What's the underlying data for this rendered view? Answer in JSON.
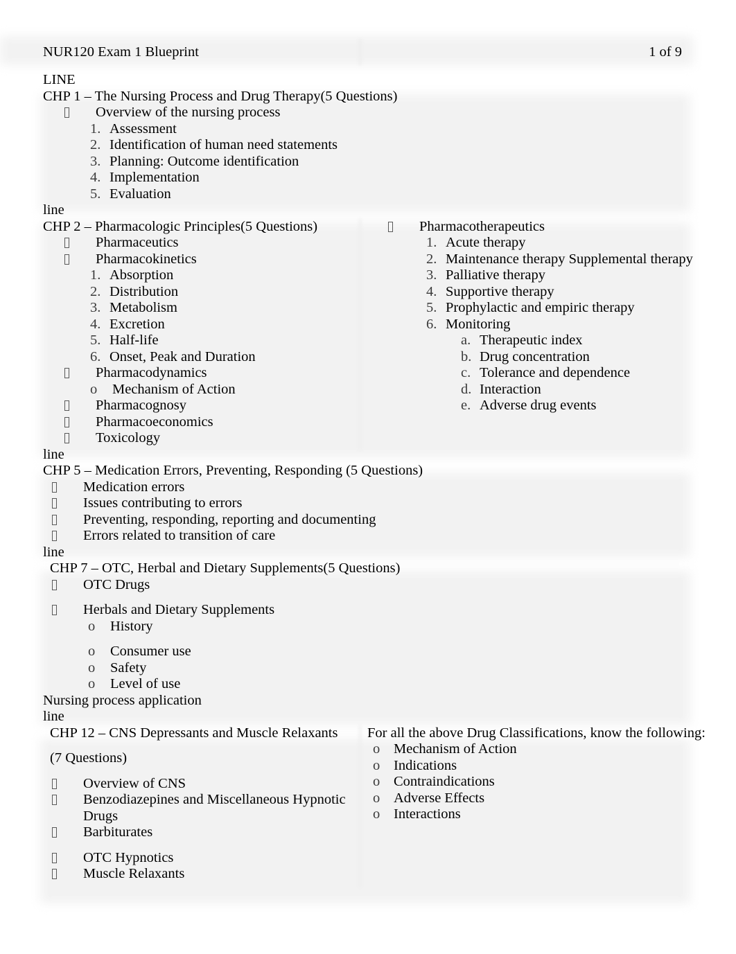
{
  "header": {
    "title": "NUR120 Exam 1 Blueprint",
    "page_indicator": "1 of 9"
  },
  "separators": {
    "upper": "LINE",
    "lower": "line"
  },
  "sections": [
    {
      "id": "chp1",
      "title": "CHP 1 – The Nursing Process and Drug Therapy(5 Questions)",
      "bullets": [
        {
          "marker": "tofu",
          "text": "Overview of the nursing process"
        }
      ],
      "numbered": [
        {
          "marker": "1.",
          "text": "Assessment"
        },
        {
          "marker": "2.",
          "text": "Identification of human need statements"
        },
        {
          "marker": "3.",
          "text": "Planning: Outcome identification"
        },
        {
          "marker": "4.",
          "text": "Implementation"
        },
        {
          "marker": "5.",
          "text": "Evaluation"
        }
      ]
    },
    {
      "id": "chp2",
      "title": "CHP 2 – Pharmacologic Principles(5 Questions)",
      "left_items": [
        {
          "depth": "b1",
          "marker": "tofu",
          "text": "Pharmaceutics"
        },
        {
          "depth": "b1",
          "marker": "tofu",
          "text": "Pharmacokinetics"
        },
        {
          "depth": "n2",
          "marker": "1.",
          "text": "Absorption"
        },
        {
          "depth": "n2",
          "marker": "2.",
          "text": "Distribution"
        },
        {
          "depth": "n2",
          "marker": "3.",
          "text": "Metabolism"
        },
        {
          "depth": "n2",
          "marker": "4.",
          "text": "Excretion"
        },
        {
          "depth": "n2",
          "marker": "5.",
          "text": "Half-life"
        },
        {
          "depth": "n2",
          "marker": "6.",
          "text": "Onset, Peak and Duration"
        },
        {
          "depth": "b1",
          "marker": "tofu",
          "text": "Pharmacodynamics"
        },
        {
          "depth": "o3",
          "marker": "o",
          "text": "Mechanism of Action"
        },
        {
          "depth": "b1",
          "marker": "tofu",
          "text": "Pharmacognosy"
        },
        {
          "depth": "b1",
          "marker": "tofu",
          "text": "Pharmacoeconomics"
        },
        {
          "depth": "b1",
          "marker": "tofu",
          "text": "Toxicology"
        }
      ],
      "right_items": [
        {
          "depth": "rb1",
          "marker": "tofu",
          "text": "Pharmacotherapeutics"
        },
        {
          "depth": "rn2",
          "marker": "1.",
          "text": "Acute therapy"
        },
        {
          "depth": "rn2",
          "marker": "2.",
          "text": "Maintenance therapy Supplemental therapy"
        },
        {
          "depth": "rn2",
          "marker": "3.",
          "text": "Palliative therapy"
        },
        {
          "depth": "rn2",
          "marker": "4.",
          "text": "Supportive therapy"
        },
        {
          "depth": "rn2",
          "marker": "5.",
          "text": "Prophylactic and empiric therapy"
        },
        {
          "depth": "rn2",
          "marker": "6.",
          "text": "Monitoring"
        },
        {
          "depth": "ra3",
          "marker": "a.",
          "text": "Therapeutic index"
        },
        {
          "depth": "ra3",
          "marker": "b.",
          "text": "Drug concentration"
        },
        {
          "depth": "ra3",
          "marker": "c.",
          "text": "Tolerance and dependence"
        },
        {
          "depth": "ra3",
          "marker": "d.",
          "text": "Interaction"
        },
        {
          "depth": "ra3",
          "marker": "e.",
          "text": "Adverse drug events"
        }
      ]
    },
    {
      "id": "chp5",
      "title": "CHP 5 – Medication Errors, Preventing, Responding (5 Questions)",
      "bullets": [
        {
          "marker": "tofu",
          "text": "Medication errors"
        },
        {
          "marker": "tofu",
          "text": "Issues contributing to errors"
        },
        {
          "marker": "tofu",
          "text": "Preventing, responding, reporting and documenting"
        },
        {
          "marker": "tofu",
          "text": "Errors related to transition of care"
        }
      ]
    },
    {
      "id": "chp7",
      "title": "CHP 7 – OTC, Herbal and Dietary Supplements(5 Questions)",
      "items": [
        {
          "depth": "b1",
          "marker": "tofu",
          "text": "OTC Drugs",
          "space_after": true
        },
        {
          "depth": "b1",
          "marker": "tofu",
          "text": "Herbals and Dietary Supplements"
        },
        {
          "depth": "o3",
          "marker": "o",
          "text": "History",
          "space_after": true
        },
        {
          "depth": "o3",
          "marker": "o",
          "text": "Consumer use"
        },
        {
          "depth": "o3",
          "marker": "o",
          "text": "Safety"
        },
        {
          "depth": "o3",
          "marker": "o",
          "text": "Level of use"
        }
      ],
      "footer_note": "Nursing process application"
    },
    {
      "id": "chp12",
      "title_line1": "CHP 12 – CNS Depressants and Muscle Relaxants",
      "title_line2": "(7 Questions)",
      "left_items": [
        {
          "depth": "b1",
          "marker": "tofu",
          "text": "Overview of CNS"
        },
        {
          "depth": "b1",
          "marker": "tofu",
          "text": "Benzodiazepines and Miscellaneous Hypnotic Drugs"
        },
        {
          "depth": "b1",
          "marker": "tofu",
          "text": "Barbiturates",
          "space_after": true
        },
        {
          "depth": "b1",
          "marker": "tofu",
          "text": "OTC Hypnotics"
        },
        {
          "depth": "b1",
          "marker": "tofu",
          "text": "Muscle Relaxants"
        }
      ],
      "right_heading": "For all the above Drug Classifications, know the following:",
      "right_items": [
        {
          "marker": "o",
          "text": "Mechanism of Action"
        },
        {
          "marker": "o",
          "text": "Indications"
        },
        {
          "marker": "o",
          "text": "Contraindications"
        },
        {
          "marker": "o",
          "text": "Adverse Effects"
        },
        {
          "marker": "o",
          "text": "Interactions"
        }
      ]
    }
  ]
}
